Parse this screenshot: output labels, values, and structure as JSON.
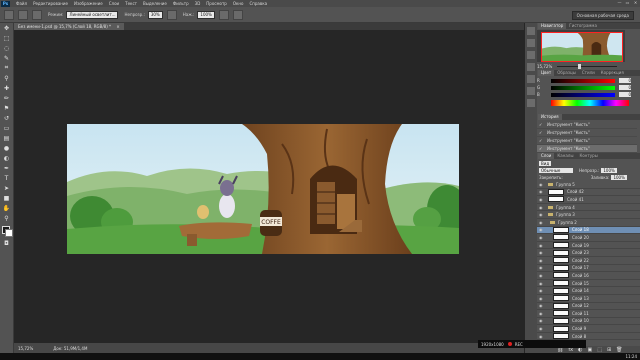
{
  "app": {
    "logo": "Ps"
  },
  "menu": [
    "Файл",
    "Редактирование",
    "Изображение",
    "Слои",
    "Текст",
    "Выделение",
    "Фильтр",
    "3D",
    "Просмотр",
    "Окно",
    "Справка"
  ],
  "window_controls": [
    "—",
    "▭",
    "✕"
  ],
  "options": {
    "mode_label": "Режим:",
    "mode_value": "Линейный осветлит...",
    "opacity_label": "Непрозр.:",
    "opacity_value": "30%",
    "flow_label": "Наж.:",
    "flow_value": "100%",
    "workspace": "Основная рабочая среда"
  },
  "document": {
    "tab": "Без имени-1.psd @ 15,7% (Слой 18, RGB/8) *",
    "close": "×",
    "zoom": "15,72%",
    "doc_info": "Док: 51,9M/1,4M"
  },
  "navigator": {
    "tabs": [
      "Навигатор",
      "Гистограмма"
    ],
    "zoom": "15,72%",
    "zoom_fraction": 0.35
  },
  "color_panel": {
    "tabs": [
      "Цвет",
      "Образцы",
      "Стили",
      "Коррекция"
    ],
    "channels": [
      {
        "ch": "R",
        "value": "0"
      },
      {
        "ch": "G",
        "value": "0"
      },
      {
        "ch": "B",
        "value": "0"
      }
    ]
  },
  "history": {
    "tab": "История",
    "items": [
      "Инструмент \"Кисть\"",
      "Инструмент \"Кисть\"",
      "Инструмент \"Кисть\"",
      "Инструмент \"Кисть\""
    ],
    "active_index": 3
  },
  "layers_panel": {
    "tabs": [
      "Слои",
      "Каналы",
      "Контуры"
    ],
    "filter": "Вид",
    "blend": "Обычные",
    "opacity_label": "Непрозр.:",
    "opacity": "100%",
    "lock_label": "Закрепить:",
    "fill_label": "Заливка:",
    "fill": "100%",
    "layers": [
      {
        "name": "Группа 5",
        "type": "folder",
        "indent": 0
      },
      {
        "name": "Слой 42",
        "type": "layer",
        "indent": 0
      },
      {
        "name": "Слой 41",
        "type": "layer",
        "indent": 0
      },
      {
        "name": "Группа 4",
        "type": "folder",
        "indent": 0
      },
      {
        "name": "Группа 3",
        "type": "folder",
        "indent": 0
      },
      {
        "name": "Группа 2",
        "type": "folder",
        "indent": 1
      },
      {
        "name": "Слой 18",
        "type": "layer",
        "indent": 1,
        "active": true
      },
      {
        "name": "Слой 20",
        "type": "layer",
        "indent": 1
      },
      {
        "name": "Слой 19",
        "type": "layer",
        "indent": 1
      },
      {
        "name": "Слой 23",
        "type": "layer",
        "indent": 1
      },
      {
        "name": "Слой 22",
        "type": "layer",
        "indent": 1
      },
      {
        "name": "Слой 17",
        "type": "layer",
        "indent": 1
      },
      {
        "name": "Слой 16",
        "type": "layer",
        "indent": 1
      },
      {
        "name": "Слой 15",
        "type": "layer",
        "indent": 1
      },
      {
        "name": "Слой 14",
        "type": "layer",
        "indent": 1
      },
      {
        "name": "Слой 13",
        "type": "layer",
        "indent": 1
      },
      {
        "name": "Слой 12",
        "type": "layer",
        "indent": 1
      },
      {
        "name": "Слой 11",
        "type": "layer",
        "indent": 1
      },
      {
        "name": "Слой 10",
        "type": "layer",
        "indent": 1
      },
      {
        "name": "Слой 9",
        "type": "layer",
        "indent": 1
      },
      {
        "name": "Слой 8",
        "type": "layer",
        "indent": 1
      }
    ],
    "footer": [
      "⛓",
      "fx",
      "◐",
      "▣",
      "⬚",
      "⊞",
      "🗑"
    ]
  },
  "recorder": {
    "time": "1920x1080",
    "label": "REC"
  },
  "taskbar": {
    "time": "11:24"
  },
  "artwork": {
    "jar_label": "COFFE"
  },
  "colors": {
    "sky": "#cfe6f0",
    "grass": "#4d9a3a",
    "tree": "#8a5a2e",
    "selection": "#6f8fb4"
  }
}
